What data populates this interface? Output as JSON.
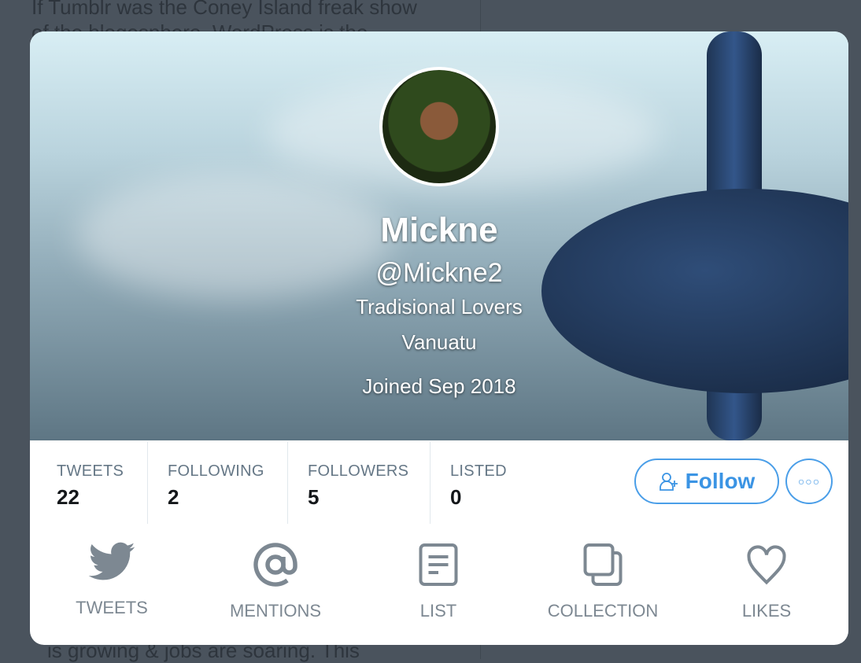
{
  "background": {
    "line1": "If Tumblr was the Coney Island freak show",
    "line2": "of the blogosphere, WordPress is the",
    "line3": "is growing & jobs are soaring. This"
  },
  "profile": {
    "name": "Mickne",
    "handle": "@Mickne2",
    "bio": "Tradisional Lovers",
    "location": "Vanuatu",
    "joined": "Joined Sep 2018"
  },
  "stats": [
    {
      "label": "TWEETS",
      "value": "22"
    },
    {
      "label": "FOLLOWING",
      "value": "2"
    },
    {
      "label": "FOLLOWERS",
      "value": "5"
    },
    {
      "label": "LISTED",
      "value": "0"
    }
  ],
  "actions": {
    "follow": "Follow",
    "more_icon": "ellipsis-icon"
  },
  "nav": [
    {
      "label": "TWEETS",
      "icon": "bird-icon"
    },
    {
      "label": "MENTIONS",
      "icon": "at-icon"
    },
    {
      "label": "LIST",
      "icon": "list-icon"
    },
    {
      "label": "COLLECTION",
      "icon": "collection-icon"
    },
    {
      "label": "LIKES",
      "icon": "heart-icon"
    }
  ],
  "colors": {
    "accent": "#3b94e4",
    "icon": "#7d8892"
  }
}
